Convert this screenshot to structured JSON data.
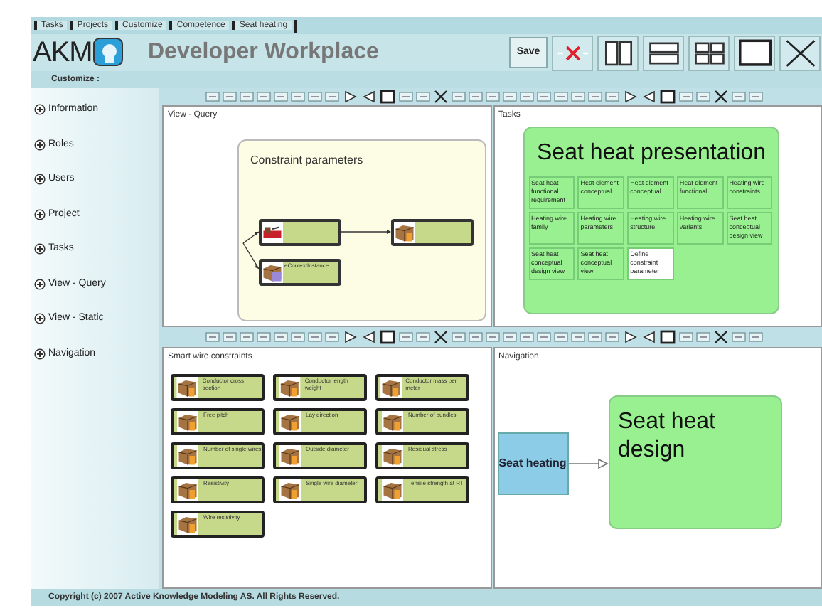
{
  "top_tabs": [
    "Tasks",
    "Projects",
    "Customize",
    "Competence",
    "Seat heating"
  ],
  "app": {
    "logo": "AKM",
    "title": "Developer Workplace"
  },
  "header_buttons": [
    {
      "kind": "save",
      "label": "Save"
    },
    {
      "kind": "delete"
    },
    {
      "kind": "columns"
    },
    {
      "kind": "rows"
    },
    {
      "kind": "grid"
    },
    {
      "kind": "single"
    },
    {
      "kind": "close"
    }
  ],
  "customize_label": "Customize :",
  "sidebar": [
    {
      "label": "Information"
    },
    {
      "label": "Roles"
    },
    {
      "label": "Users"
    },
    {
      "label": "Project"
    },
    {
      "label": "Tasks"
    },
    {
      "label": "View - Query"
    },
    {
      "label": "View - Static"
    },
    {
      "label": "Navigation"
    }
  ],
  "toolbar_buttons": [
    {
      "kind": "small"
    },
    {
      "kind": "small"
    },
    {
      "kind": "small"
    },
    {
      "kind": "small"
    },
    {
      "kind": "small"
    },
    {
      "kind": "small"
    },
    {
      "kind": "small"
    },
    {
      "kind": "small"
    },
    {
      "kind": "right"
    },
    {
      "kind": "left"
    },
    {
      "kind": "square"
    },
    {
      "kind": "small"
    },
    {
      "kind": "small"
    },
    {
      "kind": "close"
    },
    {
      "kind": "small"
    },
    {
      "kind": "small"
    }
  ],
  "panels": [
    {
      "title": "View - Query",
      "kind": "diagram",
      "model": {
        "title": "Constraint parameters",
        "nodes": [
          {
            "kind": "heater"
          },
          {
            "kind": "box"
          },
          {
            "kind": "context",
            "label": "eContextInstance"
          }
        ]
      }
    },
    {
      "title": "Tasks",
      "kind": "tiles",
      "heading": "Seat heat presentation",
      "tiles": [
        {
          "label": "Seat heat functional requirement",
          "selected": false
        },
        {
          "label": "Heat element conceptual",
          "selected": false
        },
        {
          "label": "Heat element conceptual",
          "selected": false
        },
        {
          "label": "Heat element functional",
          "selected": false
        },
        {
          "label": "Heating wire constraints",
          "selected": false
        },
        {
          "label": "Heating wire family",
          "selected": false
        },
        {
          "label": "Heating wire parameters",
          "selected": false
        },
        {
          "label": "Heating wire structure",
          "selected": false
        },
        {
          "label": "Heating wire variants",
          "selected": false
        },
        {
          "label": "Seat heat conceptual design view",
          "selected": false
        },
        {
          "label": "Seat heat conceptual design view",
          "selected": false
        },
        {
          "label": "Seat heat conceptual view",
          "selected": false
        },
        {
          "label": "Define constraint parameter",
          "selected": true
        }
      ]
    },
    {
      "title": "Smart wire constraints",
      "kind": "objects",
      "items": [
        "Conductor cross section",
        "Conductor length weight",
        "Conductor mass per meter",
        "Free pitch",
        "Lay direction",
        "Number of bundles",
        "Number of single wires",
        "Outside diameter",
        "Residual stress",
        "Resistivity",
        "Single wire diameter",
        "Tensile strength at RT",
        "Wire resistivity"
      ]
    },
    {
      "title": "Navigation",
      "kind": "navigation",
      "from": "Seat heating",
      "to": "Seat heat design"
    }
  ],
  "footer": "Copyright (c) 2007 Active Knowledge Modeling AS. All Rights Reserved."
}
